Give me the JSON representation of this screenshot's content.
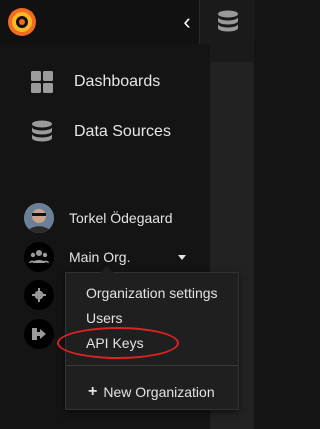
{
  "nav": {
    "dashboards_label": "Dashboards",
    "data_sources_label": "Data Sources"
  },
  "user": {
    "name": "Torkel Ödegaard",
    "org": "Main Org."
  },
  "org_menu": {
    "items": [
      "Organization settings",
      "Users",
      "API Keys"
    ],
    "new_org_label": "New Organization"
  },
  "icons": {
    "logo": "grafana-logo",
    "collapse": "chevron-left-icon",
    "dashboards": "grid-icon",
    "data_sources": "database-icon",
    "org": "users-icon",
    "settings": "gear-icon",
    "signout": "sign-out-icon",
    "plus": "plus-icon"
  },
  "colors": {
    "accent": "#f57b20",
    "highlight": "#dd2222"
  }
}
